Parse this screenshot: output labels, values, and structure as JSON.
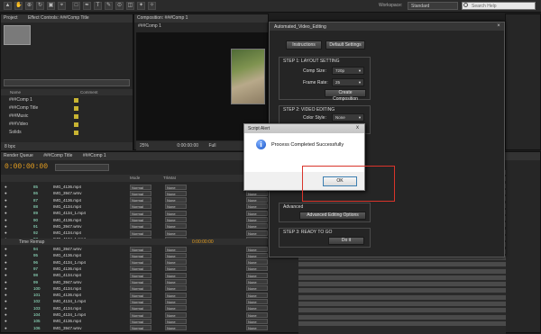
{
  "toolbar": {
    "workspace_label": "Workspace:",
    "workspace_value": "Standard",
    "search_placeholder": "Search Help"
  },
  "project_panel": {
    "tab_project": "Project",
    "tab_effect_controls": "Effect Controls: ###Comp Title",
    "columns": [
      "Name",
      "Comment"
    ],
    "items": [
      "###Comp 1",
      "###Comp Title",
      "###Music",
      "###Video",
      "Solids"
    ],
    "footer": "8 bpc"
  },
  "comp_panel": {
    "tab": "Composition: ###Comp 1",
    "subtab": "###Comp 1",
    "zoom": "25%",
    "time": "0:00:00:00",
    "res": "Full"
  },
  "timeline": {
    "tab_render_queue": "Render Queue",
    "tab_comp_title": "###Comp Title",
    "tab_comp1": "###Comp 1",
    "timecode": "0:00:00:00",
    "col_mode": "Mode",
    "col_trkmat": "TrkMat",
    "col_parent": "Parent",
    "time_remap": "Time Remap",
    "time_remap_value": "0:00:00:00",
    "mode_value": "Normal",
    "none_value": "None",
    "layers_top": [
      {
        "num": "85",
        "name": "IMG_4136.mp4"
      },
      {
        "num": "86",
        "name": "IMG_3947.wmv"
      },
      {
        "num": "87",
        "name": "IMG_4136.mp4"
      },
      {
        "num": "88",
        "name": "IMG_4134.mp4"
      },
      {
        "num": "89",
        "name": "IMG_4134_1.mp4"
      },
      {
        "num": "90",
        "name": "IMG_4136.mp4"
      },
      {
        "num": "91",
        "name": "IMG_3947.wmv"
      },
      {
        "num": "92",
        "name": "IMG_4134.mp4"
      },
      {
        "num": "93",
        "name": "IMG_4134_1.mp4"
      }
    ],
    "layers_bottom": [
      {
        "num": "94",
        "name": "IMG_3947.wmv"
      },
      {
        "num": "95",
        "name": "IMG_4136.mp4"
      },
      {
        "num": "96",
        "name": "IMG_4134_1.mp4"
      },
      {
        "num": "97",
        "name": "IMG_4136.mp4"
      },
      {
        "num": "98",
        "name": "IMG_4134.mp4"
      },
      {
        "num": "99",
        "name": "IMG_3947.wmv"
      },
      {
        "num": "100",
        "name": "IMG_4134.mp4"
      },
      {
        "num": "101",
        "name": "IMG_4136.mp4"
      },
      {
        "num": "102",
        "name": "IMG_4134_1.mp4"
      },
      {
        "num": "103",
        "name": "IMG_4134.mp4"
      },
      {
        "num": "104",
        "name": "IMG_4134_1.mp4"
      },
      {
        "num": "105",
        "name": "IMG_4136.mp4"
      },
      {
        "num": "106",
        "name": "IMG_3947.wmv"
      }
    ]
  },
  "script_window": {
    "title": "Automated_Video_Editing",
    "instructions_label": "Instructions",
    "default_settings_label": "Default Settings",
    "step1_title": "STEP 1: LAYOUT SETTING",
    "comp_size_label": "Comp Size:",
    "comp_size_value": "720p",
    "frame_rate_label": "Frame Rate:",
    "frame_rate_value": "25",
    "create_comp_label": "Create Composition",
    "step2_title": "STEP 2: VIDEO EDITING",
    "color_style_label": "Color Style:",
    "color_style_value": "None",
    "advanced_title": "Advanced",
    "advanced_btn_label": "Advanced Editing Options",
    "step3_title": "STEP 3: READY TO GO",
    "do_it_label": "Do it"
  },
  "alert": {
    "title": "Script Alert",
    "message": "Process Completed Successfully",
    "ok_label": "OK",
    "close_glyph": "x"
  },
  "colors": {
    "timecode": "#e8a020",
    "highlight_box": "#d9342b",
    "info_icon": "#1a56c7"
  }
}
